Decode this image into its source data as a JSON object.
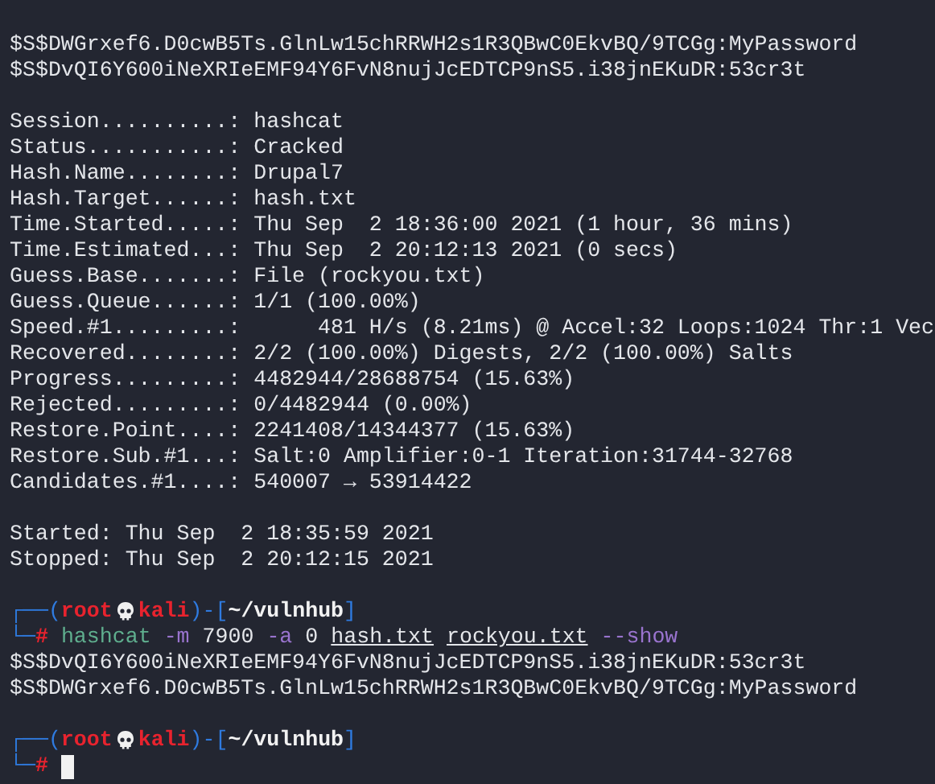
{
  "terminal": {
    "lines": [
      {
        "segments": [
          {
            "kind": "plain",
            "text": "$S$DWGrxef6.D0cwB5Ts.GlnLw15chRRWH2s1R3QBwC0EkvBQ/9TCGg:MyPassword"
          }
        ]
      },
      {
        "segments": [
          {
            "kind": "plain",
            "text": "$S$DvQI6Y600iNeXRIeEMF94Y6FvN8nujJcEDTCP9nS5.i38jnEKuDR:53cr3t"
          }
        ]
      },
      {
        "kind": "blank"
      },
      {
        "segments": [
          {
            "kind": "plain",
            "text": "Session..........: hashcat"
          }
        ]
      },
      {
        "segments": [
          {
            "kind": "plain",
            "text": "Status...........: Cracked"
          }
        ]
      },
      {
        "segments": [
          {
            "kind": "plain",
            "text": "Hash.Name........: Drupal7"
          }
        ]
      },
      {
        "segments": [
          {
            "kind": "plain",
            "text": "Hash.Target......: hash.txt"
          }
        ]
      },
      {
        "segments": [
          {
            "kind": "plain",
            "text": "Time.Started.....: Thu Sep  2 18:36:00 2021 (1 hour, 36 mins)"
          }
        ]
      },
      {
        "segments": [
          {
            "kind": "plain",
            "text": "Time.Estimated...: Thu Sep  2 20:12:13 2021 (0 secs)"
          }
        ]
      },
      {
        "segments": [
          {
            "kind": "plain",
            "text": "Guess.Base.......: File (rockyou.txt)"
          }
        ]
      },
      {
        "segments": [
          {
            "kind": "plain",
            "text": "Guess.Queue......: 1/1 (100.00%)"
          }
        ]
      },
      {
        "segments": [
          {
            "kind": "plain",
            "text": "Speed.#1.........:      481 H/s (8.21ms) @ Accel:32 Loops:1024 Thr:1 Vec"
          }
        ]
      },
      {
        "segments": [
          {
            "kind": "plain",
            "text": "Recovered........: 2/2 (100.00%) Digests, 2/2 (100.00%) Salts"
          }
        ]
      },
      {
        "segments": [
          {
            "kind": "plain",
            "text": "Progress.........: 4482944/28688754 (15.63%)"
          }
        ]
      },
      {
        "segments": [
          {
            "kind": "plain",
            "text": "Rejected.........: 0/4482944 (0.00%)"
          }
        ]
      },
      {
        "segments": [
          {
            "kind": "plain",
            "text": "Restore.Point....: 2241408/14344377 (15.63%)"
          }
        ]
      },
      {
        "segments": [
          {
            "kind": "plain",
            "text": "Restore.Sub.#1...: Salt:0 Amplifier:0-1 Iteration:31744-32768"
          }
        ]
      },
      {
        "segments": [
          {
            "kind": "plain",
            "text": "Candidates.#1....: 540007 → 53914422"
          }
        ]
      },
      {
        "kind": "blank"
      },
      {
        "segments": [
          {
            "kind": "plain",
            "text": "Started: Thu Sep  2 18:35:59 2021"
          }
        ]
      },
      {
        "segments": [
          {
            "kind": "plain",
            "text": "Stopped: Thu Sep  2 20:12:15 2021"
          }
        ]
      },
      {
        "kind": "blank"
      },
      {
        "segments": [
          {
            "kind": "frame",
            "text": "┌──("
          },
          {
            "kind": "user",
            "text": "root"
          },
          {
            "kind": "skull"
          },
          {
            "kind": "host",
            "text": "kali"
          },
          {
            "kind": "frame",
            "text": ")-["
          },
          {
            "kind": "path",
            "text": "~/vulnhub"
          },
          {
            "kind": "frame",
            "text": "]"
          }
        ]
      },
      {
        "segments": [
          {
            "kind": "frame",
            "text": "└─"
          },
          {
            "kind": "hash",
            "text": "#"
          },
          {
            "kind": "cmd",
            "text": "hashcat"
          },
          {
            "kind": "flag",
            "text": "-m"
          },
          {
            "kind": "arg",
            "text": "7900"
          },
          {
            "kind": "flag",
            "text": "-a"
          },
          {
            "kind": "arg",
            "text": "0"
          },
          {
            "kind": "file",
            "text": "hash.txt"
          },
          {
            "kind": "file",
            "text": "rockyou.txt"
          },
          {
            "kind": "flag",
            "text": "--show"
          }
        ]
      },
      {
        "segments": [
          {
            "kind": "plain",
            "text": "$S$DvQI6Y600iNeXRIeEMF94Y6FvN8nujJcEDTCP9nS5.i38jnEKuDR:53cr3t"
          }
        ]
      },
      {
        "segments": [
          {
            "kind": "plain",
            "text": "$S$DWGrxef6.D0cwB5Ts.GlnLw15chRRWH2s1R3QBwC0EkvBQ/9TCGg:MyPassword"
          }
        ]
      },
      {
        "kind": "blank"
      },
      {
        "segments": [
          {
            "kind": "frame",
            "text": "┌──("
          },
          {
            "kind": "user",
            "text": "root"
          },
          {
            "kind": "skull"
          },
          {
            "kind": "host",
            "text": "kali"
          },
          {
            "kind": "frame",
            "text": ")-["
          },
          {
            "kind": "path",
            "text": "~/vulnhub"
          },
          {
            "kind": "frame",
            "text": "]"
          }
        ]
      },
      {
        "segments": [
          {
            "kind": "frame",
            "text": "└─"
          },
          {
            "kind": "hash",
            "text": "#"
          },
          {
            "kind": "cursor"
          }
        ]
      }
    ]
  }
}
